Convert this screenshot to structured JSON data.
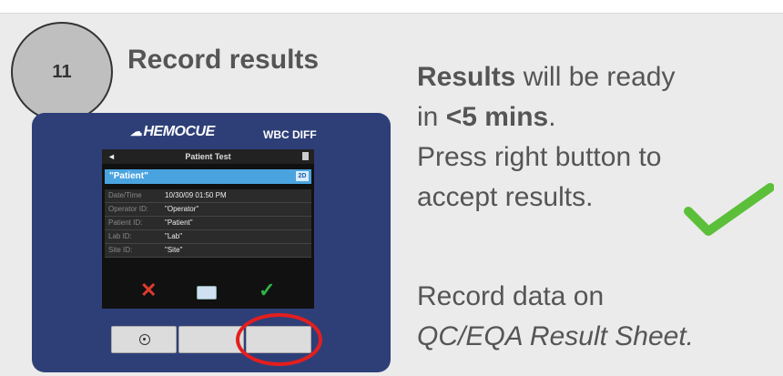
{
  "step": {
    "number": "11",
    "title": "Record results"
  },
  "instructions": {
    "line1_bold": "Results",
    "line1_rest": " will be ready",
    "line2_prefix": "in ",
    "line2_bold": "<5 mins",
    "line2_suffix": ".",
    "line3": "Press right button to",
    "line4": "accept results.",
    "record_line1": "Record data on",
    "record_line2": "QC/EQA Result Sheet."
  },
  "device": {
    "brand": "HEMOCUE",
    "model": "WBC DIFF",
    "screen": {
      "title": "Patient Test",
      "back_arrow": "◄",
      "patient_name": "\"Patient\"",
      "badge": "2D",
      "rows": [
        {
          "label": "Date/Time",
          "value": "10/30/09 01:50 PM"
        },
        {
          "label": "Operator ID:",
          "value": "\"Operator\""
        },
        {
          "label": "Patient ID:",
          "value": "\"Patient\""
        },
        {
          "label": "Lab ID:",
          "value": "\"Lab\""
        },
        {
          "label": "Site ID:",
          "value": "\"Site\""
        }
      ],
      "reject_icon": "✕",
      "accept_icon": "✓"
    }
  },
  "colors": {
    "device_body": "#2e3f78",
    "highlight_ring": "#e41e1e",
    "check_green": "#5cbf3a",
    "selected_row": "#4aa3df"
  }
}
